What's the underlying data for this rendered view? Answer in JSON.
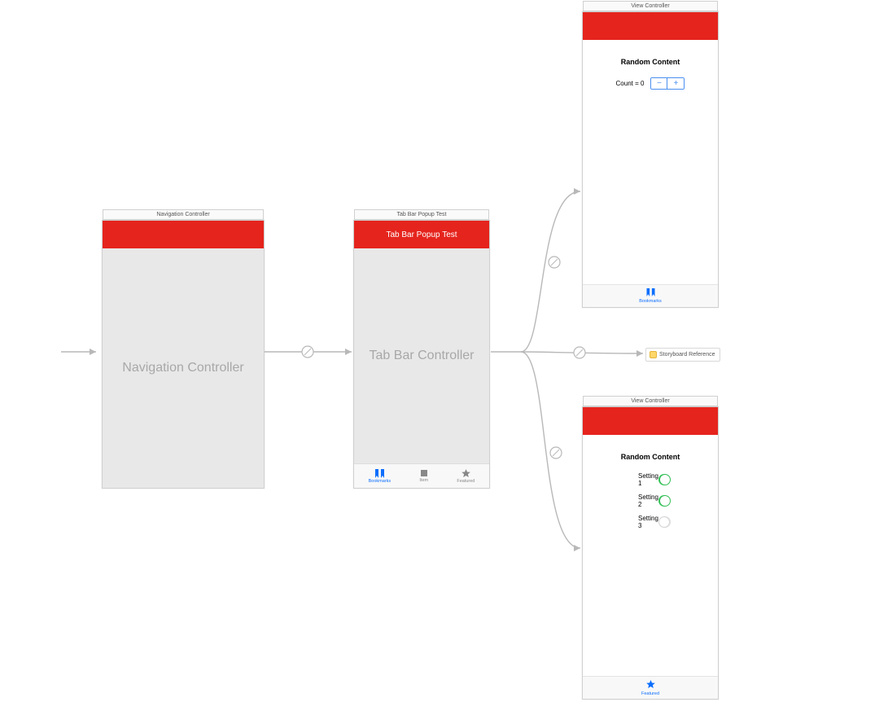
{
  "scenes": {
    "nav": {
      "title": "Navigation Controller",
      "body_label": "Navigation Controller"
    },
    "tabbar": {
      "title": "Tab Bar Popup Test",
      "nav_title": "Tab Bar Popup Test",
      "body_label": "Tab Bar Controller",
      "tabs": [
        {
          "label": "Bookmarks",
          "icon": "bookmarks",
          "active": true
        },
        {
          "label": "Item",
          "icon": "square",
          "active": false
        },
        {
          "label": "Featured",
          "icon": "star",
          "active": false
        }
      ]
    },
    "vc1": {
      "title": "View Controller",
      "heading": "Random Content",
      "count_label": "Count = 0",
      "stepper": {
        "minus": "−",
        "plus": "+"
      },
      "tab": {
        "label": "Bookmarks",
        "icon": "bookmarks"
      }
    },
    "sbref": {
      "label": "Storyboard Reference"
    },
    "vc2": {
      "title": "View Controller",
      "heading": "Random Content",
      "settings": [
        {
          "label": "Setting 1",
          "on": true
        },
        {
          "label": "Setting 2",
          "on": true
        },
        {
          "label": "Setting 3",
          "on": false
        }
      ],
      "tab": {
        "label": "Featured",
        "icon": "star"
      }
    }
  },
  "icons": {
    "bookmarks": "bookmarks-icon",
    "square": "square-icon",
    "star": "star-icon"
  }
}
